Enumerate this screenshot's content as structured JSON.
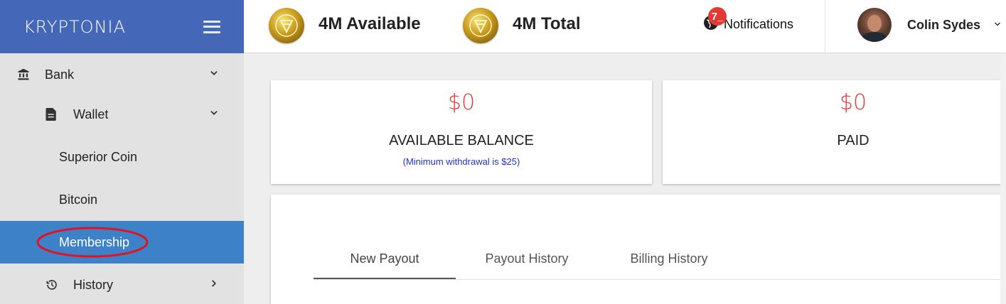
{
  "brand": {
    "name": "KRYPTONIA",
    "menu_icon": "hamburger-icon"
  },
  "sidebar": {
    "items": [
      {
        "label": "Bank",
        "icon": "bank-icon",
        "chevron": "chevron-down-icon",
        "level": 0
      },
      {
        "label": "Wallet",
        "icon": "document-icon",
        "chevron": "chevron-down-icon",
        "level": 1
      },
      {
        "label": "Superior Coin",
        "level": 2
      },
      {
        "label": "Bitcoin",
        "level": 2
      },
      {
        "label": "Membership",
        "level": 2,
        "active": true,
        "annotation": "red-ellipse"
      },
      {
        "label": "History",
        "icon": "history-icon",
        "chevron": "chevron-right-icon",
        "level": 1
      }
    ]
  },
  "header": {
    "available": "4M Available",
    "total": "4M Total",
    "notifications_label": "Notifications",
    "notifications_count": "7_",
    "user_name": "Colin Sydes"
  },
  "cards": [
    {
      "amount": "$0",
      "label": "AVAILABLE BALANCE",
      "note": "(Minimum withdrawal is $25)"
    },
    {
      "amount": "$0",
      "label": "PAID",
      "note": ""
    }
  ],
  "tabs": [
    {
      "label": "New Payout",
      "active": true
    },
    {
      "label": "Payout History",
      "active": false
    },
    {
      "label": "Billing History",
      "active": false
    }
  ],
  "colors": {
    "brand_blue": "#4567b8",
    "active_blue": "#3d82c8",
    "amount_red": "#e53935",
    "note_blue": "#1f33c8",
    "badge_red": "#e53935",
    "annotation_red": "#e0141e"
  }
}
